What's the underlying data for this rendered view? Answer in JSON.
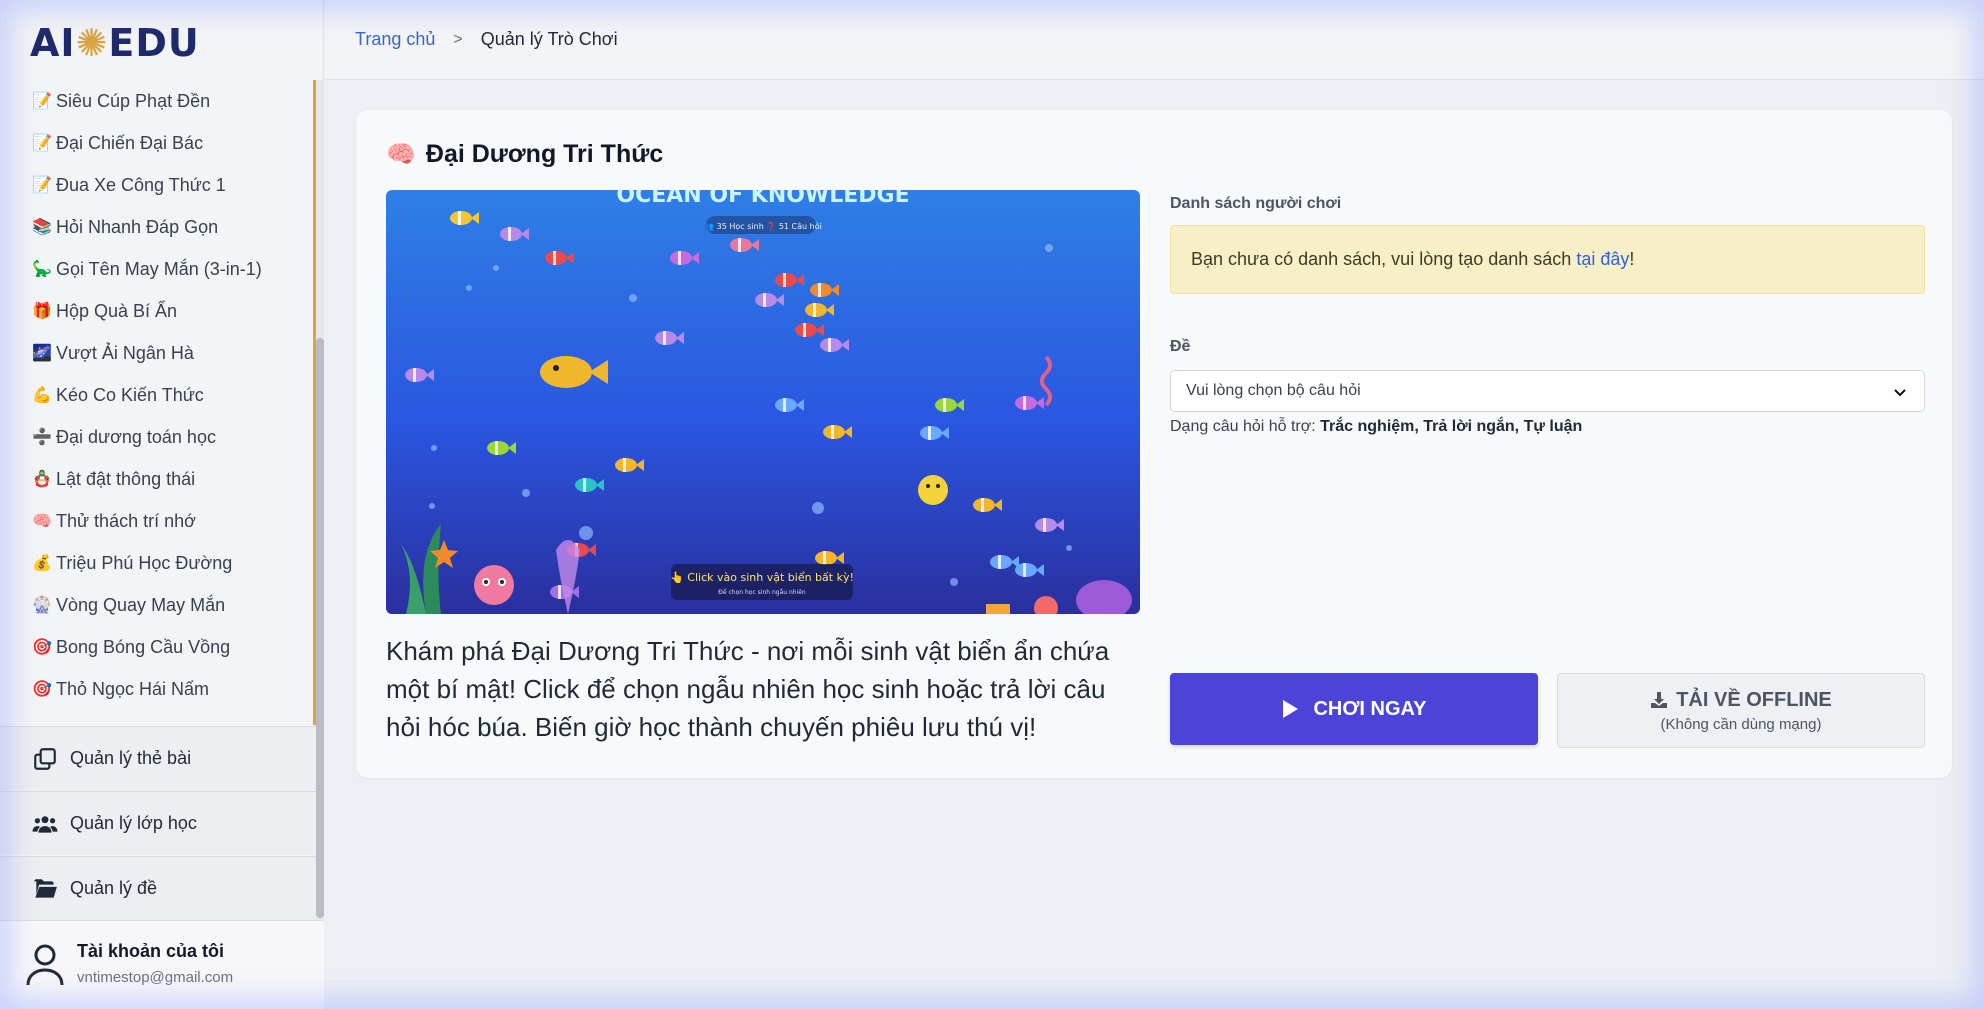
{
  "logo": {
    "text_left": "AI",
    "text_right": "EDU"
  },
  "games": [
    {
      "label": "Siêu Cúp Phạt Đền",
      "icon": "📝"
    },
    {
      "label": "Đại Chiến Đại Bác",
      "icon": "📝"
    },
    {
      "label": "Đua Xe Công Thức 1",
      "icon": "📝"
    },
    {
      "label": "Hỏi Nhanh Đáp Gọn",
      "icon": "📚"
    },
    {
      "label": "Gọi Tên May Mắn (3-in-1)",
      "icon": "🦕"
    },
    {
      "label": "Hộp Quà Bí Ẩn",
      "icon": "🎁"
    },
    {
      "label": "Vượt Ải Ngân Hà",
      "icon": "🌌"
    },
    {
      "label": "Kéo Co Kiến Thức",
      "icon": "💪"
    },
    {
      "label": "Đại dương toán học",
      "icon": "➗"
    },
    {
      "label": "Lật đật thông thái",
      "icon": "🪆"
    },
    {
      "label": "Thử thách trí nhớ",
      "icon": "🧠"
    },
    {
      "label": "Triệu Phú Học Đường",
      "icon": "💰"
    },
    {
      "label": "Vòng Quay May Mắn",
      "icon": "🎡"
    },
    {
      "label": "Bong Bóng Cầu Vồng",
      "icon": "🎯"
    },
    {
      "label": "Thỏ Ngọc Hái Nấm",
      "icon": "🎯"
    }
  ],
  "menu": {
    "cards": "Quản lý thẻ bài",
    "classes": "Quản lý lớp học",
    "exams": "Quản lý đề"
  },
  "account": {
    "title": "Tài khoản của tôi",
    "email": "vntimestop@gmail.com"
  },
  "breadcrumb": {
    "home": "Trang chủ",
    "current": "Quản lý Trò Chơi"
  },
  "game": {
    "title": "Đại Dương Tri Thức",
    "icon": "🧠",
    "description": "Khám phá Đại Dương Tri Thức - nơi mỗi sinh vật biển ẩn chứa một bí mật! Click để chọn ngẫu nhiên học sinh hoặc trả lời câu hỏi hóc búa. Biến giờ học thành chuyến phiêu lưu thú vị!",
    "preview": {
      "banner": "OCEAN OF KNOWLEDGE",
      "stats": "👥 35 Học sinh  ❓ 51 Câu hỏi",
      "hint": "👆 Click vào sinh vật biển bất kỳ!",
      "hint_sub": "Để chọn học sinh ngẫu nhiên"
    }
  },
  "players": {
    "label": "Danh sách người chơi",
    "notice": "Bạn chưa có danh sách, vui lòng tạo danh sách",
    "notice_link": "tại đây",
    "notice_end": "!"
  },
  "exam": {
    "label": "Đề",
    "placeholder": "Vui lòng chọn bộ câu hỏi",
    "support_prefix": "Dạng câu hỏi hỗ trợ:",
    "support_types": "Trắc nghiệm, Trả lời ngắn, Tự luận"
  },
  "actions": {
    "play": "CHƠI NGAY",
    "download": "TẢI VỀ OFFLINE",
    "download_sub": "(Không cần dùng mạng)"
  },
  "colors": {
    "accent": "#4c44d9",
    "brand": "#1e2a6b",
    "gold": "#d9a441",
    "link": "#3b63d8"
  }
}
